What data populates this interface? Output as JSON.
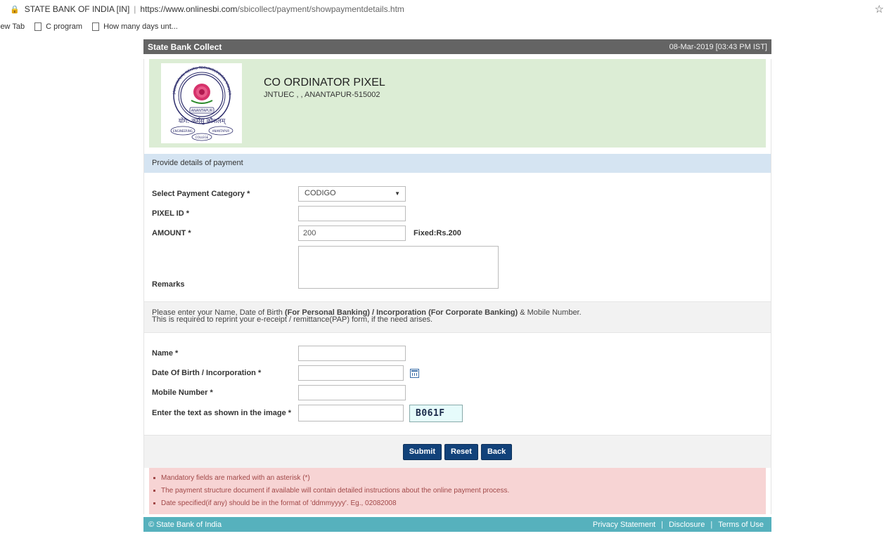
{
  "browser": {
    "site_name": "STATE BANK OF INDIA [IN]",
    "url_host": "https://www.onlinesbi.com",
    "url_path": "/sbicollect/payment/showpaymentdetails.htm",
    "bookmarks": [
      "lew Tab",
      "C program",
      "How many days unt..."
    ]
  },
  "header": {
    "title": "State Bank Collect",
    "datetime": "08-Mar-2019 [03:43 PM IST]"
  },
  "merchant": {
    "name": "CO ORDINATOR PIXEL",
    "address": "JNTUEC , , ANANTAPUR-515002",
    "logo_text": {
      "top": "JAWAHARLAL NEHRU TECHNOLOGICAL UNIVERSITY",
      "place": "ANANTAPUR",
      "motto": "योग: कर्मसु कौशलम्",
      "left": "ENGINEERING",
      "right": "ANANTAPUR",
      "bottom": "COLLEGE"
    }
  },
  "payment_section": {
    "heading": "Provide details of payment",
    "category_label": "Select Payment Category *",
    "category_value": "CODIGO",
    "pixel_id_label": "PIXEL ID *",
    "pixel_id_value": "",
    "amount_label": "AMOUNT *",
    "amount_value": "200",
    "amount_note": "Fixed:Rs.200",
    "remarks_label": "Remarks"
  },
  "info": {
    "line1_a": "Please enter your Name, Date of Birth ",
    "line1_b": "(For Personal Banking) / Incorporation (For Corporate Banking)",
    "line1_c": " & Mobile Number.",
    "line2": "This is required to reprint your e-receipt / remittance(PAP) form, if the need arises."
  },
  "personal_section": {
    "name_label": "Name *",
    "dob_label": "Date Of Birth / Incorporation *",
    "mobile_label": "Mobile Number *",
    "captcha_label": "Enter the text as shown in the image *",
    "captcha_text": "B061F"
  },
  "buttons": {
    "submit": "Submit",
    "reset": "Reset",
    "back": "Back"
  },
  "notes": [
    "Mandatory fields are marked with an asterisk (*)",
    "The payment structure document if available will contain detailed instructions about the online payment process.",
    "Date specified(if any) should be in the format of 'ddmmyyyy'. Eg., 02082008"
  ],
  "footer": {
    "copyright": "© State Bank of India",
    "privacy": "Privacy Statement",
    "disclosure": "Disclosure",
    "terms": "Terms of Use"
  },
  "colors": {
    "topbar": "#646464",
    "merchant_bg": "#dcedd5",
    "section_head": "#d5e4f2",
    "button": "#12427a",
    "notes_bg": "#f7d4d4",
    "footer": "#56b1bd"
  }
}
